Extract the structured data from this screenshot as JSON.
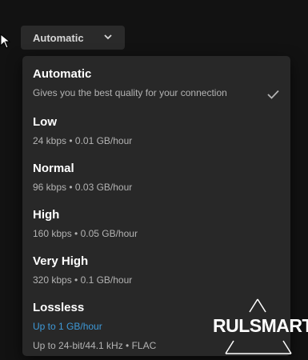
{
  "select": {
    "label": "Automatic",
    "icon": "chevron-down-icon"
  },
  "options": [
    {
      "title": "Automatic",
      "description": "Gives you the best quality for your connection",
      "selected": true
    },
    {
      "title": "Low",
      "description": "24 kbps • 0.01 GB/hour"
    },
    {
      "title": "Normal",
      "description": "96 kbps • 0.03 GB/hour"
    },
    {
      "title": "High",
      "description": "160 kbps • 0.05 GB/hour"
    },
    {
      "title": "Very High",
      "description": "320 kbps • 0.1 GB/hour"
    },
    {
      "title": "Lossless",
      "description": "Up to 1 GB/hour",
      "description_secondary": "Up to 24-bit/44.1 kHz • FLAC"
    }
  ],
  "watermark": {
    "text": "RULSMART"
  },
  "colors": {
    "background": "#121212",
    "menu": "#282828",
    "link": "#3e99d8"
  }
}
